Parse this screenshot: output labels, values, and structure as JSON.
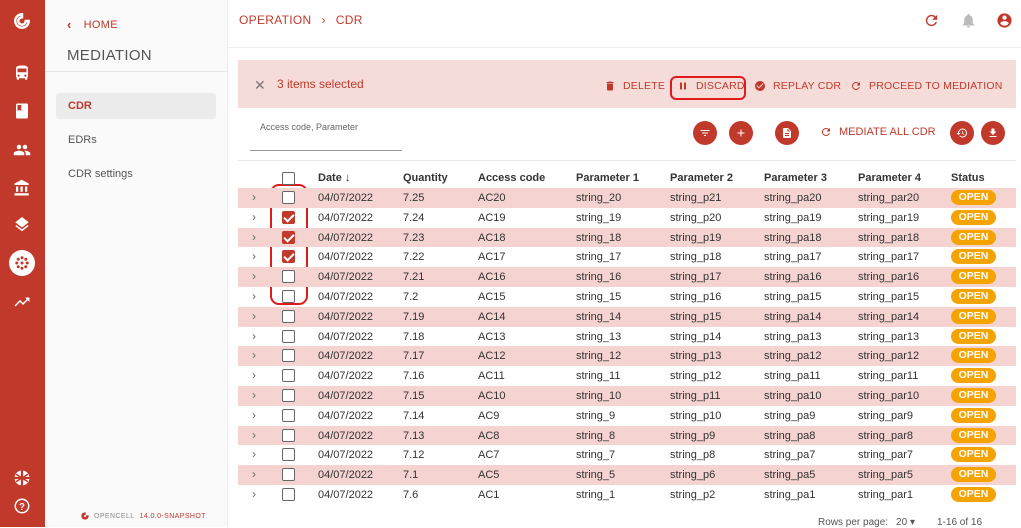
{
  "rail": {
    "icons": [
      "opencell-logo-icon",
      "bus-icon",
      "book-icon",
      "people-icon",
      "bank-icon",
      "layers-icon",
      "mediation-icon",
      "trending-up-icon",
      "uk-flag-icon",
      "help-icon"
    ],
    "active": "mediation-icon"
  },
  "sidebar": {
    "home_label": "HOME",
    "title": "MEDIATION",
    "items": [
      {
        "label": "CDR",
        "active": true
      },
      {
        "label": "EDRs",
        "active": false
      },
      {
        "label": "CDR settings",
        "active": false
      }
    ],
    "brand": "OPENCELL",
    "version": "14.0.0-SNAPSHOT"
  },
  "header": {
    "breadcrumb": [
      "OPERATION",
      "CDR"
    ]
  },
  "selection_bar": {
    "count_label": "3 items selected",
    "actions": {
      "delete": "DELETE",
      "discard": "DISCARD",
      "replay": "REPLAY CDR",
      "proceed": "PROCEED TO MEDIATION"
    }
  },
  "toolbar": {
    "search_placeholder": "Access code, Parameter",
    "mediate_all": "MEDIATE ALL CDR"
  },
  "table": {
    "columns": [
      "Date",
      "Quantity",
      "Access code",
      "Parameter 1",
      "Parameter 2",
      "Parameter 3",
      "Parameter 4",
      "Status"
    ],
    "sort_icon": "arrow-down-icon",
    "rows": [
      {
        "date": "04/07/2022",
        "qty": "7.25",
        "code": "AC20",
        "p1": "string_20",
        "p2": "string_p21",
        "p3": "string_pa20",
        "p4": "string_par20",
        "status": "OPEN",
        "checked": false
      },
      {
        "date": "04/07/2022",
        "qty": "7.24",
        "code": "AC19",
        "p1": "string_19",
        "p2": "string_p20",
        "p3": "string_pa19",
        "p4": "string_par19",
        "status": "OPEN",
        "checked": true
      },
      {
        "date": "04/07/2022",
        "qty": "7.23",
        "code": "AC18",
        "p1": "string_18",
        "p2": "string_p19",
        "p3": "string_pa18",
        "p4": "string_par18",
        "status": "OPEN",
        "checked": true
      },
      {
        "date": "04/07/2022",
        "qty": "7.22",
        "code": "AC17",
        "p1": "string_17",
        "p2": "string_p18",
        "p3": "string_pa17",
        "p4": "string_par17",
        "status": "OPEN",
        "checked": true
      },
      {
        "date": "04/07/2022",
        "qty": "7.21",
        "code": "AC16",
        "p1": "string_16",
        "p2": "string_p17",
        "p3": "string_pa16",
        "p4": "string_par16",
        "status": "OPEN",
        "checked": false
      },
      {
        "date": "04/07/2022",
        "qty": "7.2",
        "code": "AC15",
        "p1": "string_15",
        "p2": "string_p16",
        "p3": "string_pa15",
        "p4": "string_par15",
        "status": "OPEN",
        "checked": false
      },
      {
        "date": "04/07/2022",
        "qty": "7.19",
        "code": "AC14",
        "p1": "string_14",
        "p2": "string_p15",
        "p3": "string_pa14",
        "p4": "string_par14",
        "status": "OPEN",
        "checked": false
      },
      {
        "date": "04/07/2022",
        "qty": "7.18",
        "code": "AC13",
        "p1": "string_13",
        "p2": "string_p14",
        "p3": "string_pa13",
        "p4": "string_par13",
        "status": "OPEN",
        "checked": false
      },
      {
        "date": "04/07/2022",
        "qty": "7.17",
        "code": "AC12",
        "p1": "string_12",
        "p2": "string_p13",
        "p3": "string_pa12",
        "p4": "string_par12",
        "status": "OPEN",
        "checked": false
      },
      {
        "date": "04/07/2022",
        "qty": "7.16",
        "code": "AC11",
        "p1": "string_11",
        "p2": "string_p12",
        "p3": "string_pa11",
        "p4": "string_par11",
        "status": "OPEN",
        "checked": false
      },
      {
        "date": "04/07/2022",
        "qty": "7.15",
        "code": "AC10",
        "p1": "string_10",
        "p2": "string_p11",
        "p3": "string_pa10",
        "p4": "string_par10",
        "status": "OPEN",
        "checked": false
      },
      {
        "date": "04/07/2022",
        "qty": "7.14",
        "code": "AC9",
        "p1": "string_9",
        "p2": "string_p10",
        "p3": "string_pa9",
        "p4": "string_par9",
        "status": "OPEN",
        "checked": false
      },
      {
        "date": "04/07/2022",
        "qty": "7.13",
        "code": "AC8",
        "p1": "string_8",
        "p2": "string_p9",
        "p3": "string_pa8",
        "p4": "string_par8",
        "status": "OPEN",
        "checked": false
      },
      {
        "date": "04/07/2022",
        "qty": "7.12",
        "code": "AC7",
        "p1": "string_7",
        "p2": "string_p8",
        "p3": "string_pa7",
        "p4": "string_par7",
        "status": "OPEN",
        "checked": false
      },
      {
        "date": "04/07/2022",
        "qty": "7.1",
        "code": "AC5",
        "p1": "string_5",
        "p2": "string_p6",
        "p3": "string_pa5",
        "p4": "string_par5",
        "status": "OPEN",
        "checked": false
      },
      {
        "date": "04/07/2022",
        "qty": "7.6",
        "code": "AC1",
        "p1": "string_1",
        "p2": "string_p2",
        "p3": "string_pa1",
        "p4": "string_par1",
        "status": "OPEN",
        "checked": false
      }
    ]
  },
  "pagination": {
    "rows_per_page_label": "Rows per page:",
    "rows_per_page": "20",
    "range": "1-16 of 16"
  },
  "colors": {
    "brand": "#c0392b",
    "row_highlight": "#f4d3d0",
    "status_open": "#f5a300",
    "annotation": "#e01b1b"
  }
}
